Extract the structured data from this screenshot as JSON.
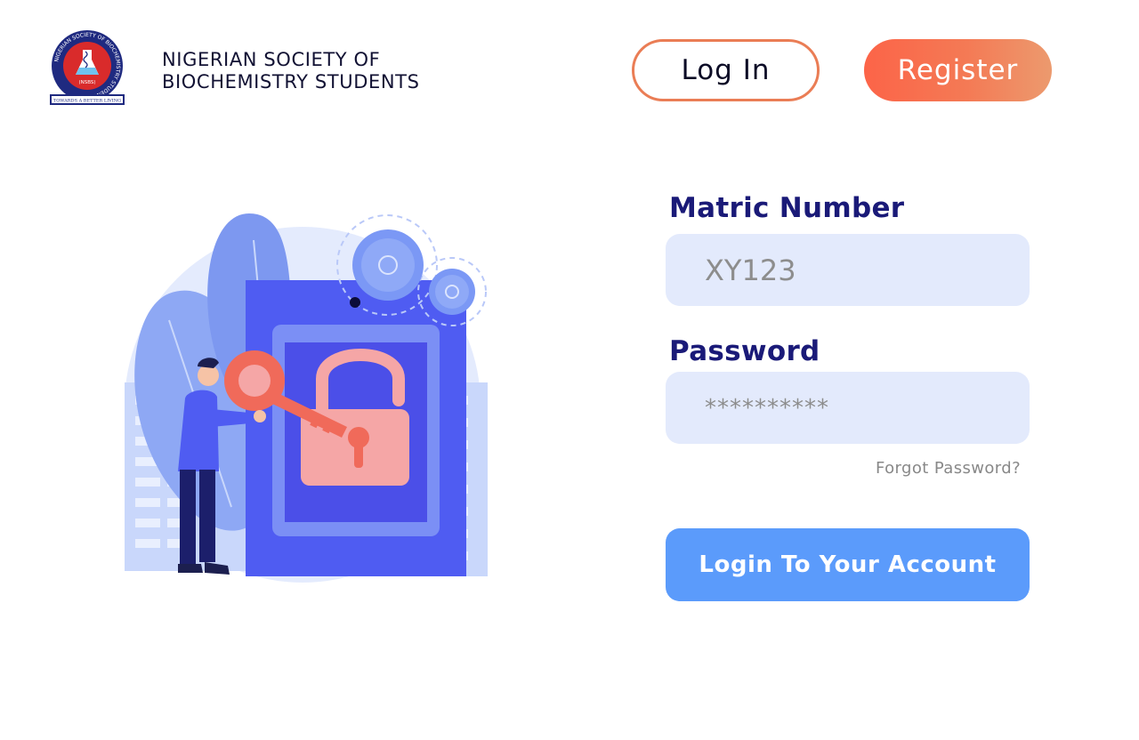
{
  "brand": {
    "line1": "NIGERIAN SOCIETY OF",
    "line2": "BIOCHEMISTRY STUDENTS",
    "logo_ring_text": "NIGERIAN SOCIETY OF BIOCHEMISTRY STUDENTS",
    "logo_abbr": "(NSBS)",
    "logo_motto": "TOWARDS A BETTER LIVING"
  },
  "nav": {
    "login_label": "Log In",
    "register_label": "Register"
  },
  "form": {
    "matric_label": "Matric Number",
    "matric_placeholder": "XY123",
    "password_label": "Password",
    "password_placeholder": "**********",
    "forgot_label": "Forgot Password?",
    "submit_label": "Login To Your Account"
  },
  "illustration": {
    "icon": "security-lock-key-illustration"
  },
  "colors": {
    "accent_orange": "#f4694b",
    "primary_blue": "#5b9bfb",
    "label_navy": "#1a1a78",
    "field_bg": "#e3eafc"
  }
}
